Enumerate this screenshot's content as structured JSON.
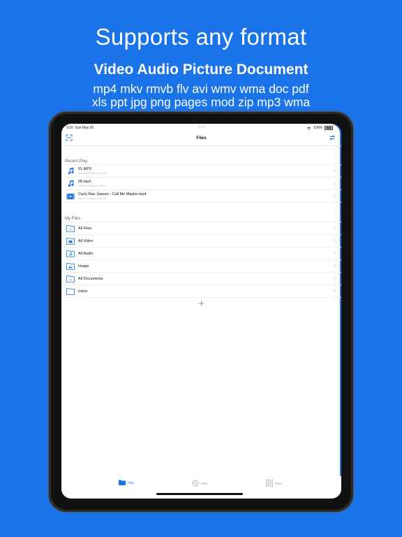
{
  "promo": {
    "headline": "Supports any format",
    "subheadline": "Video Audio Picture Document",
    "formats_line1": "mp4 mkv rmvb flv avi wmv wma doc pdf",
    "formats_line2": "xls ppt jpg png pages mod zip mp3 wma"
  },
  "statusbar": {
    "time": "9:10",
    "date": "Sun May 26",
    "battery": "100%"
  },
  "navbar": {
    "title": "Files"
  },
  "recent": {
    "title": "Recent Play",
    "items": [
      {
        "name": "01.MP3",
        "sub": "Just now Played: 0:00:08",
        "icon": "music-note-icon"
      },
      {
        "name": "05.mp3",
        "sub": "Just now Played: 0:00:01",
        "icon": "music-note-icon"
      },
      {
        "name": "Carly Rae Jepsen - Call Me Maybe.mp4",
        "sub": "Just now Played: 0:00:06",
        "icon": "video-file-icon"
      }
    ]
  },
  "my_files": {
    "title": "My Files",
    "items": [
      {
        "name": "All Files",
        "icon": "all-files-folder-icon"
      },
      {
        "name": "All Video",
        "icon": "video-folder-icon"
      },
      {
        "name": "All Audio",
        "icon": "audio-folder-icon"
      },
      {
        "name": "Image",
        "icon": "image-folder-icon"
      },
      {
        "name": "All Documents",
        "icon": "documents-folder-icon"
      },
      {
        "name": "Inbox",
        "icon": "inbox-folder-icon"
      }
    ]
  },
  "add_label": "+",
  "tabs": [
    {
      "label": "Files",
      "icon": "folder-icon",
      "active": true
    },
    {
      "label": "Web",
      "icon": "compass-icon",
      "active": false
    },
    {
      "label": "More",
      "icon": "grid-icon",
      "active": false
    }
  ],
  "colors": {
    "accent": "#1a73e8",
    "background": "#1a73e8"
  }
}
